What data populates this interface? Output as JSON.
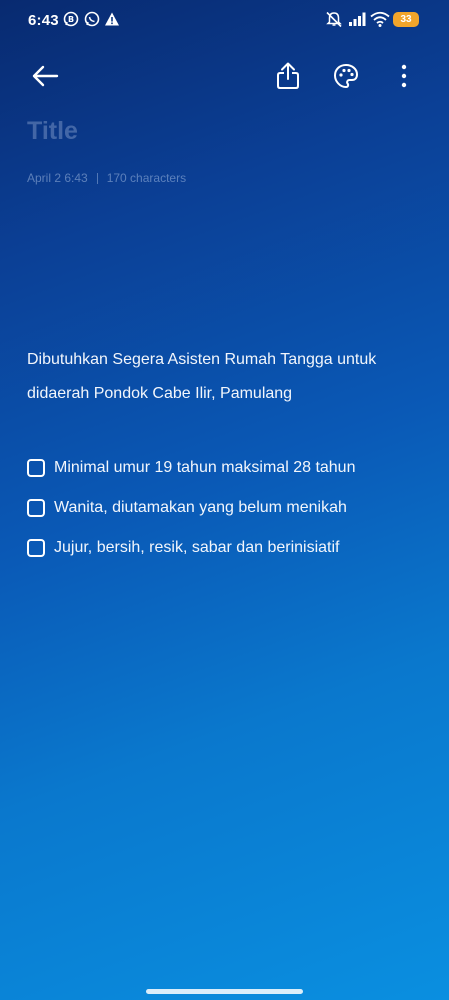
{
  "status_bar": {
    "time": "6:43",
    "battery": "33",
    "left_icons": [
      "whatsapp-business-icon",
      "whatsapp-icon",
      "warning-icon"
    ],
    "right_icons": [
      "mute-icon",
      "signal-icon",
      "wifi-icon",
      "battery-icon"
    ],
    "battery_color": "#f2a52b"
  },
  "toolbar": {
    "icons": [
      "back-arrow-icon",
      "share-icon",
      "palette-icon",
      "more-vert-icon"
    ]
  },
  "note": {
    "title_placeholder": "Title",
    "date": "April 2 6:43",
    "char_count": "170 characters",
    "body": "Dibutuhkan Segera Asisten Rumah Tangga untuk didaerah Pondok Cabe Ilir, Pamulang",
    "checklist": [
      {
        "label": "Minimal umur 19 tahun maksimal 28 tahun",
        "checked": false
      },
      {
        "label": "Wanita, diutamakan yang belum menikah",
        "checked": false
      },
      {
        "label": "Jujur, bersih, resik, sabar dan berinisiatif",
        "checked": false
      }
    ]
  }
}
